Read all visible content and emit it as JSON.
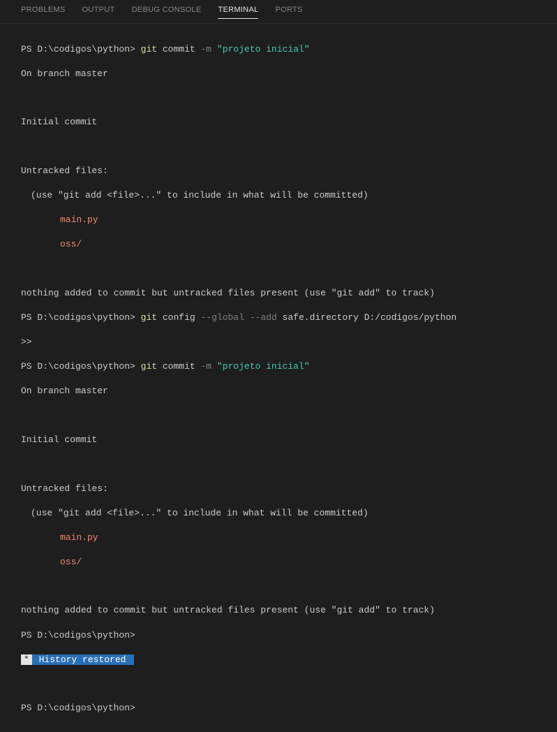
{
  "tabs": {
    "problems": "PROBLEMS",
    "output": "OUTPUT",
    "debug_console": "DEBUG CONSOLE",
    "terminal": "TERMINAL",
    "ports": "PORTS"
  },
  "prompt": "PS D:\\codigos\\python>",
  "prompt_short": ">>",
  "git": "git",
  "cmd_commit": "commit",
  "cmd_config": "config",
  "flag_m": "-m",
  "flag_global": "--global",
  "flag_add": "--add",
  "commit_msg": "\"projeto inicial\"",
  "config_arg": "safe.directory D:/codigos/python",
  "on_branch": "On branch master",
  "initial_commit": "Initial commit",
  "untracked_files": "Untracked files:",
  "use_git_add": "(use \"git add <file>...\" to include in what will be committed)",
  "file_main": "main.py",
  "file_oss": "oss/",
  "nothing_added": "nothing added to commit but untracked files present (use \"git add\" to track)",
  "history_star": "*",
  "history_restored": " History restored "
}
